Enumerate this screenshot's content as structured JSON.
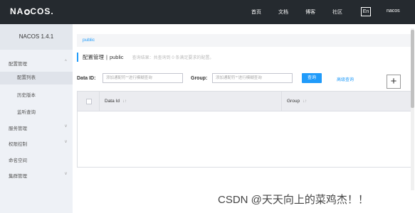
{
  "topbar": {
    "logo": "NACOS.",
    "nav": [
      "首页",
      "文档",
      "博客",
      "社区"
    ],
    "lang": "En",
    "user": "nacos"
  },
  "sidebar": {
    "title": "NACOS 1.4.1",
    "items": [
      {
        "label": "配置管理",
        "type": "group",
        "chevron": "^"
      },
      {
        "label": "配置列表",
        "type": "sub",
        "active": true
      },
      {
        "label": "历史版本",
        "type": "sub"
      },
      {
        "label": "监听查询",
        "type": "sub"
      },
      {
        "label": "服务管理",
        "type": "group",
        "chevron": "v"
      },
      {
        "label": "权限控制",
        "type": "group",
        "chevron": "v"
      },
      {
        "label": "命名空间",
        "type": "group"
      },
      {
        "label": "集群管理",
        "type": "group",
        "chevron": "v"
      }
    ]
  },
  "main": {
    "breadcrumb": "public",
    "page_title": "配置管理",
    "namespace": "public",
    "hint": "查询结果：共查询到 0 条满足要求的配置。",
    "filters": {
      "data_id_label": "Data ID:",
      "data_id_placeholder": "添加通配符'*'进行模糊查询",
      "group_label": "Group:",
      "group_placeholder": "添加通配符'*'进行模糊查询",
      "query_button": "查询",
      "advanced_link": "高级查询",
      "add_button": "+"
    },
    "table": {
      "columns": [
        "Data Id",
        "Group"
      ],
      "sort_icon": "↓↑"
    }
  },
  "watermark": "CSDN @天天向上的菜鸡杰！！",
  "colors": {
    "topbar": "#252a2f",
    "accent": "#209bfa",
    "sidebar": "#eef1f6"
  }
}
